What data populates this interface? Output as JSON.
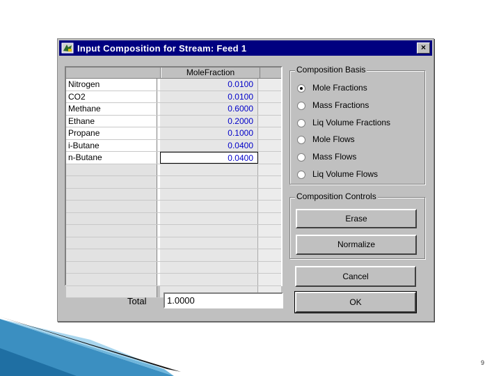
{
  "window": {
    "title": "Input Composition for Stream: Feed 1",
    "close_label": "×"
  },
  "grid": {
    "column_header": "MoleFraction",
    "rows": [
      {
        "name": "Nitrogen",
        "value": "0.0100"
      },
      {
        "name": "CO2",
        "value": "0.0100"
      },
      {
        "name": "Methane",
        "value": "0.6000"
      },
      {
        "name": "Ethane",
        "value": "0.2000"
      },
      {
        "name": "Propane",
        "value": "0.1000"
      },
      {
        "name": "i-Butane",
        "value": "0.0400"
      },
      {
        "name": "n-Butane",
        "value": "0.0400"
      }
    ]
  },
  "total": {
    "label": "Total",
    "value": "1.0000"
  },
  "composition_basis": {
    "title": "Composition Basis",
    "options": [
      "Mole Fractions",
      "Mass Fractions",
      "Liq Volume Fractions",
      "Mole Flows",
      "Mass Flows",
      "Liq Volume Flows"
    ],
    "selected": "Mole Fractions"
  },
  "composition_controls": {
    "title": "Composition Controls",
    "erase_label": "Erase",
    "normalize_label": "Normalize"
  },
  "buttons": {
    "cancel_label": "Cancel",
    "ok_label": "OK"
  },
  "slide": {
    "page_number": "9"
  },
  "colors": {
    "titlebar": "#000080",
    "value_text": "#0000c8",
    "dialog_face": "#c0c0c0"
  }
}
